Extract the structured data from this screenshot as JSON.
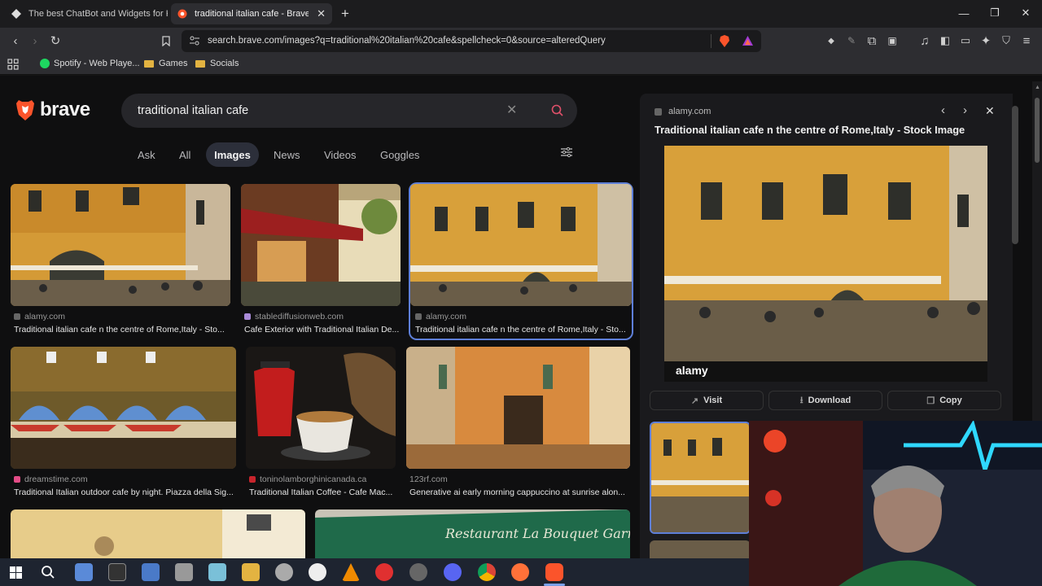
{
  "browser": {
    "tabs": [
      {
        "title": "The best ChatBot and Widgets for Ki"
      },
      {
        "title": "traditional italian cafe - Brave Se"
      }
    ],
    "url": "search.brave.com/images?q=traditional%20italian%20cafe&spellcheck=0&source=alteredQuery",
    "bookmarks": [
      {
        "label": "Spotify - Web Playe..."
      },
      {
        "label": "Games"
      },
      {
        "label": "Socials"
      }
    ]
  },
  "search": {
    "brand": "brave",
    "query": "traditional italian cafe",
    "tabs": [
      "Ask",
      "All",
      "Images",
      "News",
      "Videos",
      "Goggles"
    ],
    "active_tab": "Images"
  },
  "results": [
    {
      "source": "alamy.com",
      "title": "Traditional italian cafe n the centre of Rome,Italy - Sto..."
    },
    {
      "source": "stablediffusionweb.com",
      "title": "Cafe Exterior with Traditional Italian De..."
    },
    {
      "source": "alamy.com",
      "title": "Traditional italian cafe n the centre of Rome,Italy - Sto..."
    },
    {
      "source": "dreamstime.com",
      "title": "Traditional Italian outdoor cafe by night. Piazza della Sig..."
    },
    {
      "source": "toninolamborghinicanada.ca",
      "title": "Traditional Italian Coffee - Cafe Mac..."
    },
    {
      "source": "123rf.com",
      "title": "Generative ai early morning cappuccino at sunrise alon..."
    }
  ],
  "preview": {
    "source": "alamy.com",
    "title": "Traditional italian cafe n the centre of Rome,Italy - Stock Image",
    "watermark": "alamy",
    "buttons": [
      "Visit",
      "Download",
      "Copy"
    ]
  },
  "banner_text": "Restaurant La Bouquet Garni",
  "colors": {
    "accent": "#5e7fd8",
    "brand": "#fb542b",
    "page_bg": "#0f0f10"
  }
}
